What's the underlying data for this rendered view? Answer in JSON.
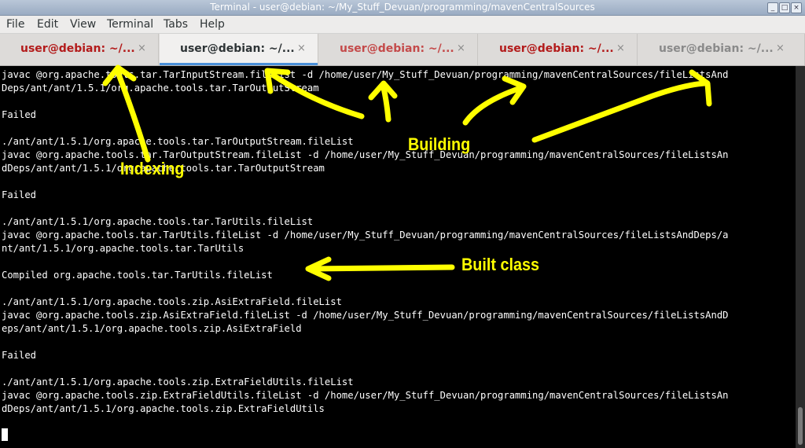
{
  "window": {
    "title": "Terminal - user@debian: ~/My_Stuff_Devuan/programming/mavenCentralSources",
    "controls": [
      "_",
      "□",
      "×"
    ]
  },
  "menu": [
    "File",
    "Edit",
    "View",
    "Terminal",
    "Tabs",
    "Help"
  ],
  "tabs": [
    {
      "label": "user@debian: ~/...",
      "close": "×",
      "color": "#b31b1b",
      "active": false
    },
    {
      "label": "user@debian: ~/...",
      "close": "×",
      "color": "#2e3436",
      "active": true
    },
    {
      "label": "user@debian: ~/...",
      "close": "×",
      "color": "#c44a4a",
      "active": false
    },
    {
      "label": "user@debian: ~/...",
      "close": "×",
      "color": "#b31b1b",
      "active": false
    },
    {
      "label": "user@debian: ~/...",
      "close": "×",
      "color": "#8a8a8a",
      "active": false
    }
  ],
  "terminal": {
    "lines": [
      "javac @org.apache.tools.tar.TarInputStream.fileList -d /home/user/My_Stuff_Devuan/programming/mavenCentralSources/fileListsAnd",
      "Deps/ant/ant/1.5.1/org.apache.tools.tar.TarOutputStream",
      "",
      "Failed",
      "",
      "./ant/ant/1.5.1/org.apache.tools.tar.TarOutputStream.fileList",
      "javac @org.apache.tools.tar.TarOutputStream.fileList -d /home/user/My_Stuff_Devuan/programming/mavenCentralSources/fileListsAn",
      "dDeps/ant/ant/1.5.1/org.apache.tools.tar.TarOutputStream",
      "",
      "Failed",
      "",
      "./ant/ant/1.5.1/org.apache.tools.tar.TarUtils.fileList",
      "javac @org.apache.tools.tar.TarUtils.fileList -d /home/user/My_Stuff_Devuan/programming/mavenCentralSources/fileListsAndDeps/a",
      "nt/ant/1.5.1/org.apache.tools.tar.TarUtils",
      "",
      "Compiled org.apache.tools.tar.TarUtils.fileList",
      "",
      "./ant/ant/1.5.1/org.apache.tools.zip.AsiExtraField.fileList",
      "javac @org.apache.tools.zip.AsiExtraField.fileList -d /home/user/My_Stuff_Devuan/programming/mavenCentralSources/fileListsAndD",
      "eps/ant/ant/1.5.1/org.apache.tools.zip.AsiExtraField",
      "",
      "Failed",
      "",
      "./ant/ant/1.5.1/org.apache.tools.zip.ExtraFieldUtils.fileList",
      "javac @org.apache.tools.zip.ExtraFieldUtils.fileList -d /home/user/My_Stuff_Devuan/programming/mavenCentralSources/fileListsAn",
      "dDeps/ant/ant/1.5.1/org.apache.tools.zip.ExtraFieldUtils"
    ]
  },
  "annotations": {
    "indexing": "Indexing",
    "building": "Building",
    "built_class": "Built class",
    "color": "#ffff00"
  }
}
